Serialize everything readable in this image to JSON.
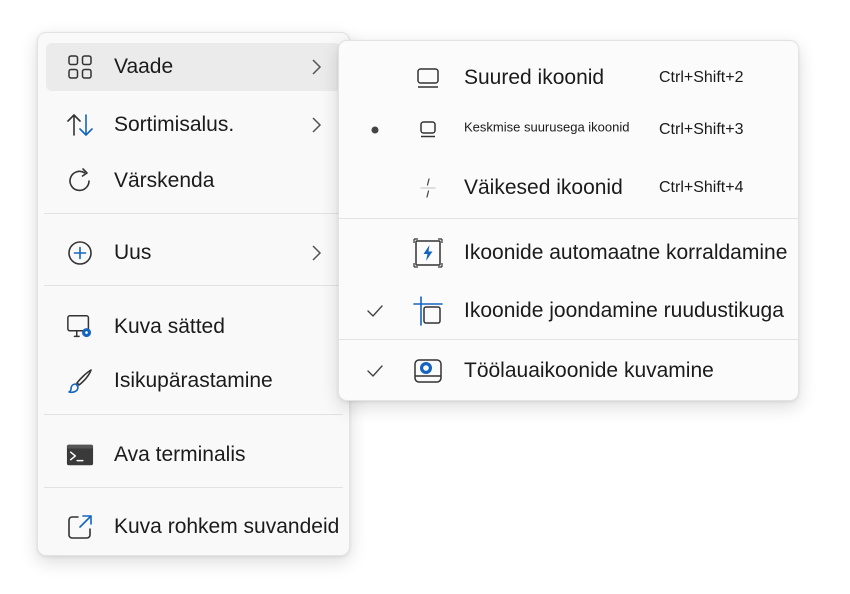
{
  "main_menu": {
    "items": [
      {
        "label": "Vaade",
        "icon": "grid-view-icon",
        "has_submenu": true,
        "highlighted": true
      },
      {
        "label": "Sortimisalus.",
        "icon": "sort-arrows-icon",
        "has_submenu": true
      },
      {
        "label": "Värskenda",
        "icon": "refresh-icon",
        "has_submenu": false
      },
      {
        "label": "Uus",
        "icon": "add-circle-icon",
        "has_submenu": true
      },
      {
        "label": "Kuva sätted",
        "icon": "display-settings-icon",
        "has_submenu": false
      },
      {
        "label": "Isikupärastamine",
        "icon": "paintbrush-icon",
        "has_submenu": false
      },
      {
        "label": "Ava terminalis",
        "icon": "terminal-icon",
        "has_submenu": false
      },
      {
        "label": "Kuva rohkem suvandeid",
        "icon": "share-external-icon",
        "has_submenu": false
      }
    ]
  },
  "view_submenu": {
    "items": [
      {
        "label": "Suured ikoonid",
        "shortcut": "Ctrl+Shift+2",
        "icon": "large-icons-icon",
        "selected": false
      },
      {
        "label": "Keskmise suurusega ikoonid",
        "shortcut": "Ctrl+Shift+3",
        "icon": "medium-icons-icon",
        "selected": true
      },
      {
        "label": "Väikesed ikoonid",
        "shortcut": "Ctrl+Shift+4",
        "icon": "small-icons-icon",
        "selected": false
      },
      {
        "label": "Ikoonide automaatne korraldamine",
        "icon": "auto-arrange-icon",
        "checked": false
      },
      {
        "label": "Ikoonide joondamine ruudustikuga",
        "icon": "align-grid-icon",
        "checked": true
      },
      {
        "label": "Töölauaikoonide kuvamine",
        "icon": "show-desktop-icons-icon",
        "checked": true
      }
    ]
  },
  "colors": {
    "accent": "#1565c0",
    "text": "#1b1b1b",
    "menu_bg": "#f9f9f9",
    "hover_bg": "#ebebeb",
    "separator": "#e2e2e2"
  }
}
